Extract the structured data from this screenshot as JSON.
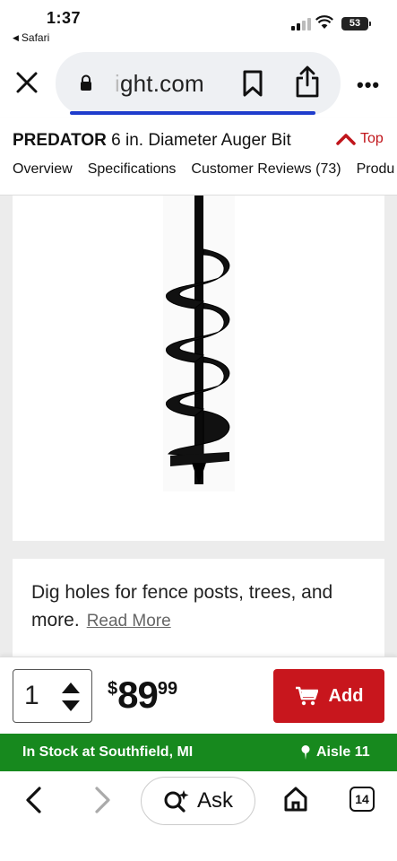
{
  "status_bar": {
    "time": "1:37",
    "back_app": "Safari",
    "battery": "53"
  },
  "browser": {
    "url_faded": "i",
    "url": "ght.com",
    "icons": [
      "close-icon",
      "lock-icon",
      "bookmark-icon",
      "share-icon",
      "more-icon"
    ]
  },
  "product_header": {
    "brand": "PREDATOR",
    "title": "6 in. Diameter Auger Bit",
    "top_label": "Top",
    "tabs": [
      "Overview",
      "Specifications",
      "Customer Reviews (73)",
      "Produ"
    ]
  },
  "description": {
    "text": "Dig holes for fence posts, trees, and more.",
    "read_more": "Read More"
  },
  "purchase": {
    "quantity": "1",
    "currency": "$",
    "price_dollars": "89",
    "price_cents": "99",
    "add_label": "Add"
  },
  "stock": {
    "status": "In Stock at Southfield, MI",
    "aisle": "Aisle 11"
  },
  "toolbar": {
    "ask_label": "Ask",
    "tab_count": "14"
  },
  "colors": {
    "brand_red": "#c8161d",
    "stock_green": "#17891e",
    "progress_blue": "#1e3ccc"
  }
}
